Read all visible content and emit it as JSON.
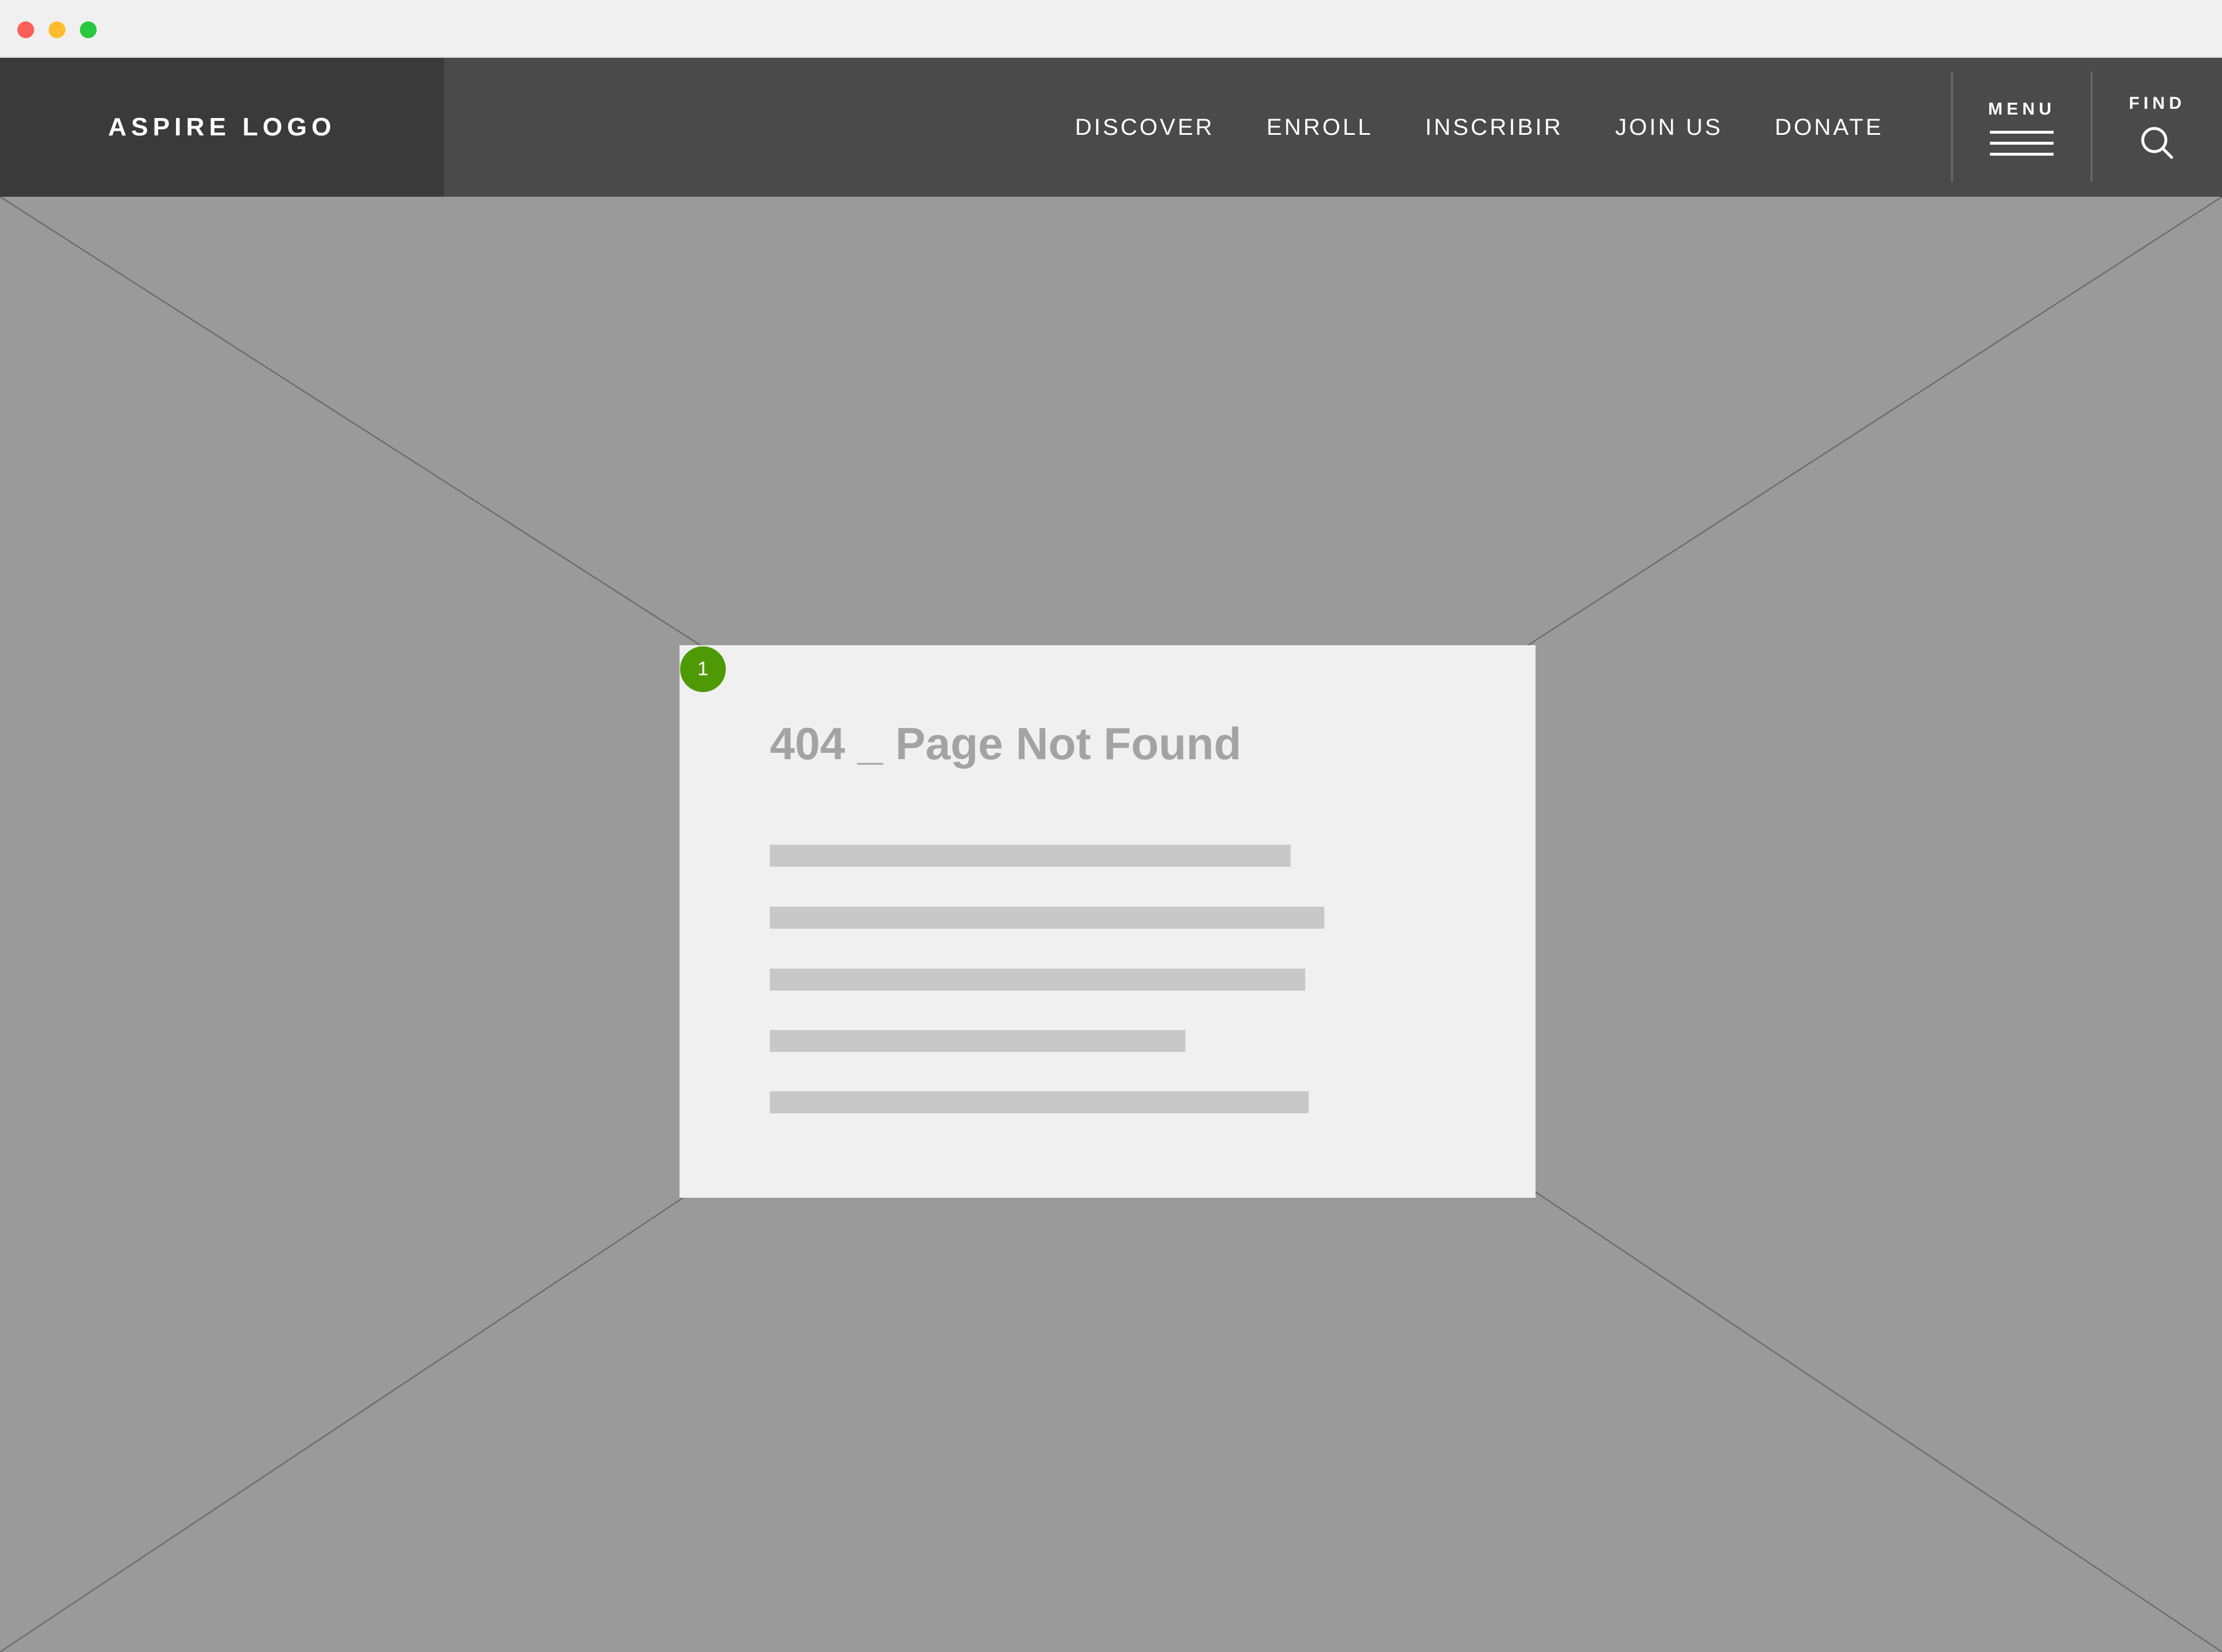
{
  "window": {
    "controls": [
      "close",
      "minimize",
      "maximize"
    ]
  },
  "header": {
    "logo": "ASPIRE LOGO",
    "nav": [
      {
        "label": "DISCOVER"
      },
      {
        "label": "ENROLL"
      },
      {
        "label": "INSCRIBIR"
      },
      {
        "label": "JOIN US"
      },
      {
        "label": "DONATE"
      }
    ],
    "menu_label": "MENU",
    "find_label": "FIND",
    "menu_icon": "hamburger-icon",
    "find_icon": "search-icon"
  },
  "content": {
    "title": "404 _ Page Not Found",
    "annotation_number": "1",
    "placeholder_line_count": 5
  },
  "colors": {
    "navbar": "#4a4a4a",
    "logo_block": "#3a3a3a",
    "hero_placeholder": "#9a9a9a",
    "card": "#f0f0f0",
    "badge": "#4e9a06",
    "title_text": "#a3a3a3",
    "text_placeholder": "#c8c8c8"
  }
}
